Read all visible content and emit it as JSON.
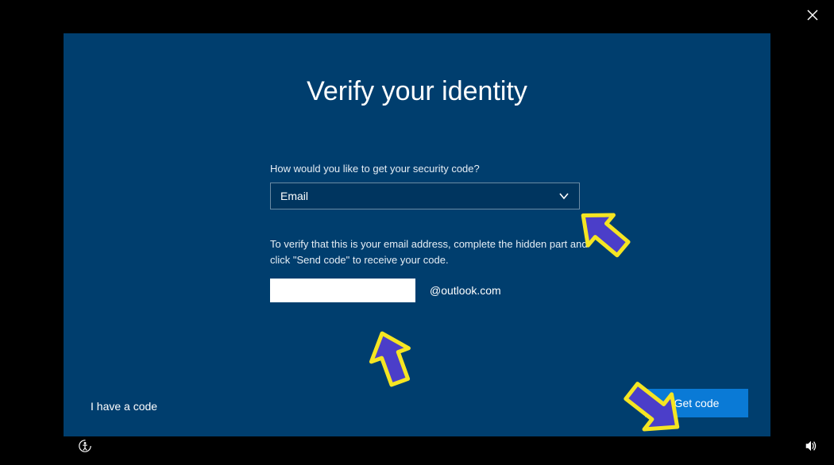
{
  "title": "Verify your identity",
  "prompt": "How would you like to get your security code?",
  "dropdownValue": "Email",
  "instruction": "To verify that this is your email address, complete the hidden part and click \"Send code\" to receive your code.",
  "emailInputValue": "",
  "emailDomain": "@outlook.com",
  "haveCodeLink": "I have a code",
  "getCodeButton": "Get code"
}
